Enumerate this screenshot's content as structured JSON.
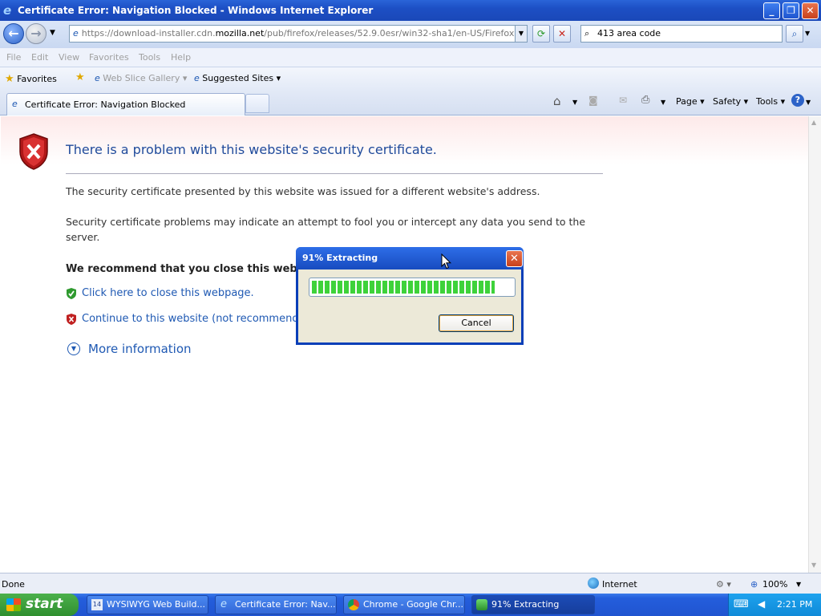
{
  "window": {
    "title": "Certificate Error: Navigation Blocked - Windows Internet Explorer"
  },
  "address": {
    "url_prefix": "https://download-installer.cdn.",
    "url_host": "mozilla.net",
    "url_suffix": "/pub/firefox/releases/52.9.0esr/win32-sha1/en-US/Firefox%20Setup"
  },
  "search": {
    "value": "413 area code"
  },
  "menu": [
    "File",
    "Edit",
    "View",
    "Favorites",
    "Tools",
    "Help"
  ],
  "favorites": {
    "label": "Favorites",
    "web_slice": "Web Slice Gallery",
    "suggested": "Suggested Sites"
  },
  "tab": {
    "title": "Certificate Error: Navigation Blocked"
  },
  "command_bar": {
    "page": "Page",
    "safety": "Safety",
    "tools": "Tools"
  },
  "content": {
    "heading": "There is a problem with this website's security certificate.",
    "p1": "The security certificate presented by this website was issued for a different website's address.",
    "p2": "Security certificate problems may indicate an attempt to fool you or intercept any data you send to the server.",
    "recommend": "We recommend that you close this webpag",
    "close_link": "Click here to close this webpage.",
    "continue_link": "Continue to this website (not recommended",
    "more_info": "More information"
  },
  "status": {
    "text": "Done",
    "zone": "Internet",
    "zoom": "100%"
  },
  "taskbar": {
    "start": "start",
    "tasks": [
      "WYSIWYG Web Build...",
      "Certificate Error: Nav...",
      "Chrome - Google Chr...",
      "91% Extracting"
    ],
    "clock": "2:21 PM"
  },
  "dialog": {
    "title": "91% Extracting",
    "progress_percent": 91,
    "cancel": "Cancel"
  },
  "colors": {
    "accent": "#1f59b3",
    "progress": "#3ed23a",
    "title_bar": "#1d4fc4"
  }
}
